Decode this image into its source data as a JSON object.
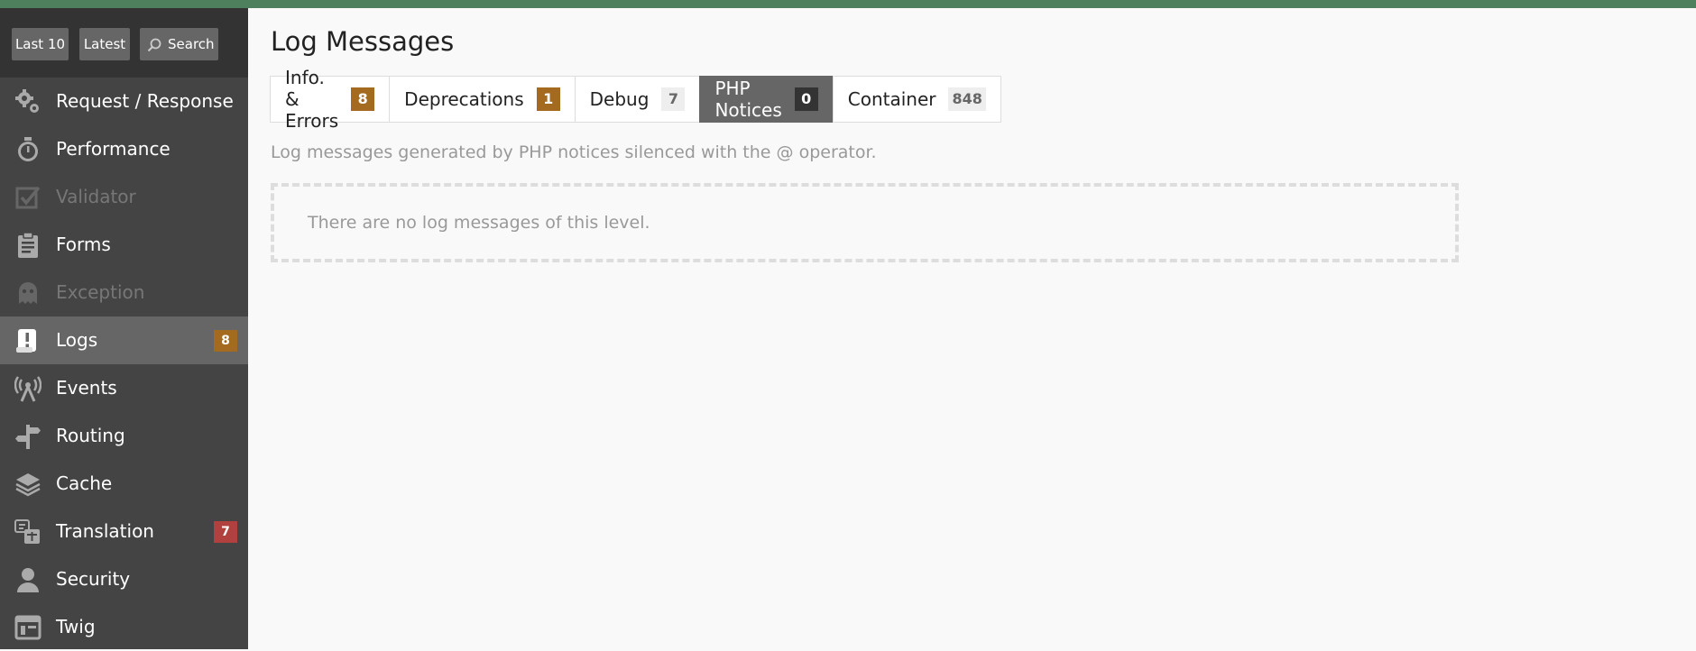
{
  "colors": {
    "topbar": "#4f805d",
    "sidebar": "#444444",
    "sidebar_header": "#333333",
    "selected_item": "#666666",
    "badge_warning": "#a46a1f",
    "badge_error": "#b0413e"
  },
  "toolbar": {
    "last10_label": "Last 10",
    "latest_label": "Latest",
    "search_label": "Search"
  },
  "sidebar": {
    "items": [
      {
        "label": "Request / Response",
        "icon": "gears-icon"
      },
      {
        "label": "Performance",
        "icon": "stopwatch-icon"
      },
      {
        "label": "Validator",
        "icon": "checkbox-icon",
        "disabled": true
      },
      {
        "label": "Forms",
        "icon": "form-icon"
      },
      {
        "label": "Exception",
        "icon": "ghost-icon",
        "disabled": true
      },
      {
        "label": "Logs",
        "icon": "logs-icon",
        "count": "8",
        "selected": true
      },
      {
        "label": "Events",
        "icon": "events-icon"
      },
      {
        "label": "Routing",
        "icon": "signpost-icon"
      },
      {
        "label": "Cache",
        "icon": "layers-icon"
      },
      {
        "label": "Translation",
        "icon": "translation-icon",
        "count": "7"
      },
      {
        "label": "Security",
        "icon": "user-icon"
      },
      {
        "label": "Twig",
        "icon": "template-icon"
      }
    ]
  },
  "main": {
    "title": "Log Messages",
    "tabs": [
      {
        "label": "Info. & Errors",
        "count": "8"
      },
      {
        "label": "Deprecations",
        "count": "1"
      },
      {
        "label": "Debug",
        "count": "7"
      },
      {
        "label": "PHP Notices",
        "count": "0",
        "active": true
      },
      {
        "label": "Container",
        "count": "848"
      }
    ],
    "help_text": "Log messages generated by PHP notices silenced with the @ operator.",
    "empty_message": "There are no log messages of this level."
  }
}
